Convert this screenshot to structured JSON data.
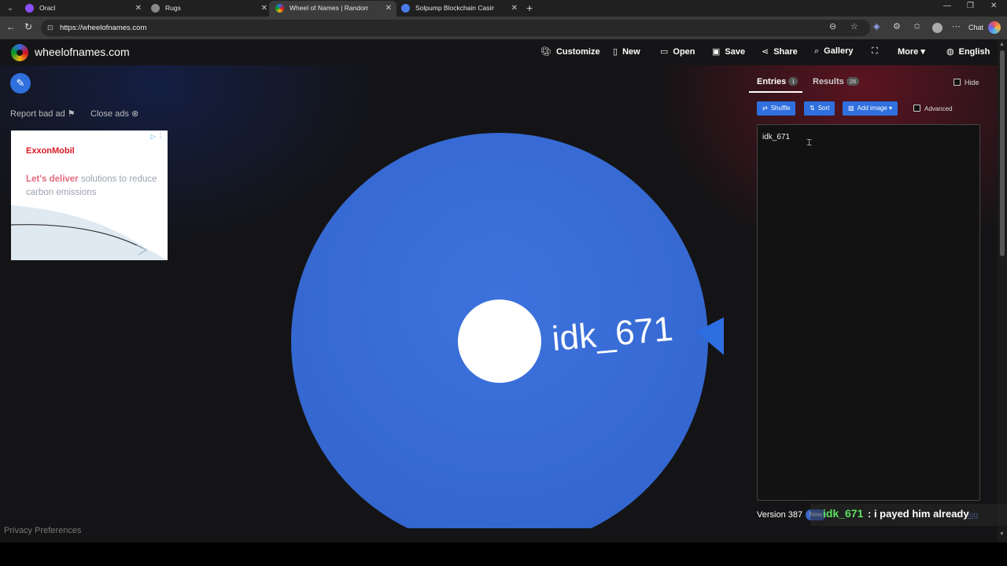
{
  "browser": {
    "tabs": [
      {
        "title": "Oracl",
        "favicon_color": "#8a4fff"
      },
      {
        "title": "Rugs",
        "favicon_color": "#888888"
      },
      {
        "title": "Wheel of Names | Random name",
        "favicon_color": "#e04a3b"
      },
      {
        "title": "Solpump Blockchain Casino | Sola",
        "favicon_color": "#4a7be8"
      }
    ],
    "url": "https://wheelofnames.com",
    "chat_label": "Chat"
  },
  "site": {
    "name": "wheelofnames.com",
    "nav": {
      "customize": "Customize",
      "new": "New",
      "open": "Open",
      "save": "Save",
      "share": "Share",
      "gallery": "Gallery",
      "more": "More",
      "language": "English"
    }
  },
  "ads": {
    "report": "Report bad ad",
    "close": "Close ads",
    "brand": "ExxonMobil",
    "headline_bold": "Let's deliver",
    "headline_rest": " solutions to reduce carbon emissions"
  },
  "wheel": {
    "segment_label": "idk_671",
    "color": "#3b6fd6"
  },
  "panel": {
    "tabs": {
      "entries": "Entries",
      "entries_count": "1",
      "results": "Results",
      "results_count": "28"
    },
    "hide_label": "Hide",
    "buttons": {
      "shuffle": "Shuffle",
      "sort": "Sort",
      "add_image": "Add image"
    },
    "advanced_label": "Advanced",
    "entries_text": "idk_671",
    "version": "Version 387",
    "new_badge": "New",
    "changelog": "log"
  },
  "chat_overlay": {
    "user": "idk_671",
    "message": ": i payed him already"
  },
  "footer": {
    "privacy": "Privacy Preferences"
  }
}
